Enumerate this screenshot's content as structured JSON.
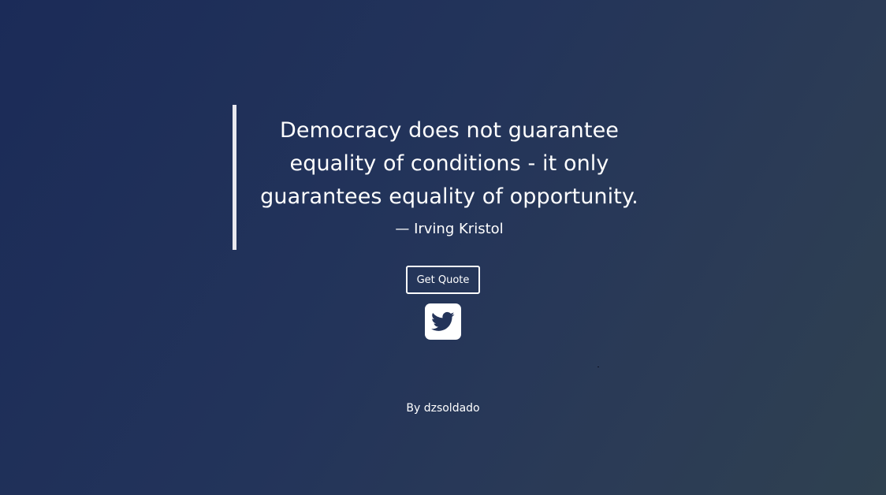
{
  "quote": {
    "text": "Democracy does not guarantee equality of conditions - it only guarantees equality of opportunity.",
    "author": "— Irving Kristol"
  },
  "actions": {
    "get_quote_label": "Get Quote",
    "tweet_icon": "twitter-icon"
  },
  "footer": {
    "credit": "By dzsoldado"
  },
  "colors": {
    "background_start": "#1b2b58",
    "background_end": "#2f4150",
    "text": "#ffffff",
    "quote_bar": "#e8e8ee",
    "tweet_icon": "#24345a"
  }
}
